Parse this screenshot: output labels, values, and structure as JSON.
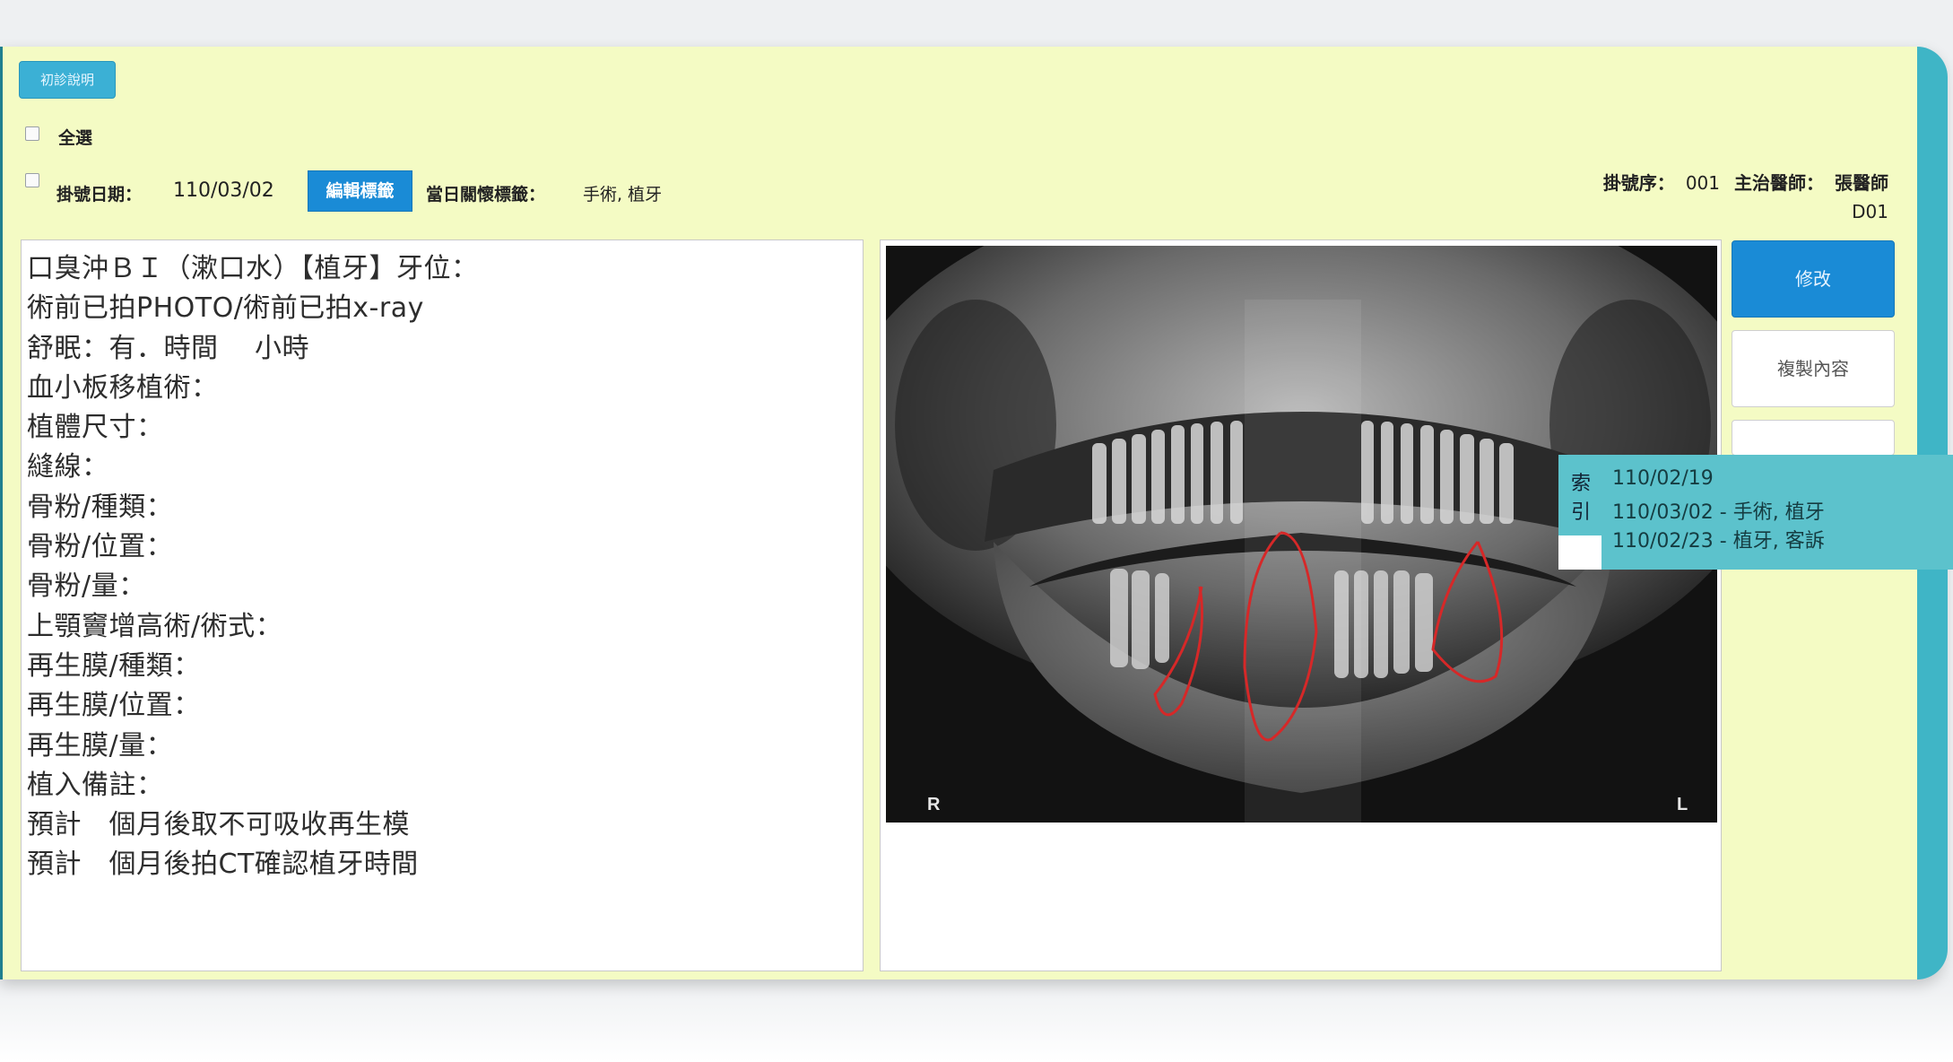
{
  "toolbar": {
    "intro_button": "初診說明"
  },
  "select_all": {
    "label": "全選"
  },
  "visit": {
    "date_label": "掛號日期：",
    "date_value": "110/03/02",
    "edit_tags_button": "編輯標籤",
    "tags_label": "當日關懷標籤：",
    "tags_value": "手術, 植牙"
  },
  "registration": {
    "seq_label": "掛號序：",
    "seq_value": "001",
    "doctor_label": "主治醫師：",
    "doctor_value": "張醫師",
    "doctor_code": "D01"
  },
  "notes": {
    "lines": [
      "口臭沖ＢＩ（漱口水）【植牙】牙位：",
      "術前已拍PHOTO/術前已拍x-ray",
      "舒眠：有．時間　 小時",
      "血小板移植術：",
      "植體尺寸：",
      "縫線：",
      "骨粉/種類：",
      "骨粉/位置：",
      "骨粉/量：",
      "上顎竇增高術/術式：",
      "再生膜/種類：",
      "再生膜/位置：",
      "再生膜/量：",
      "植入備註：",
      "預計　個月後取不可吸收再生模",
      "預計　個月後拍CT確認植牙時間"
    ]
  },
  "xray": {
    "left_marker": "R",
    "right_marker": "L",
    "annotation_color": "#d62828"
  },
  "actions": {
    "modify_button": "修改",
    "copy_button": "複製內容"
  },
  "history_popup": {
    "marks": [
      "索",
      "引"
    ],
    "entries": [
      "110/02/19",
      "110/03/02 - 手術, 植牙",
      "110/02/23 - 植牙, 客訴"
    ]
  }
}
